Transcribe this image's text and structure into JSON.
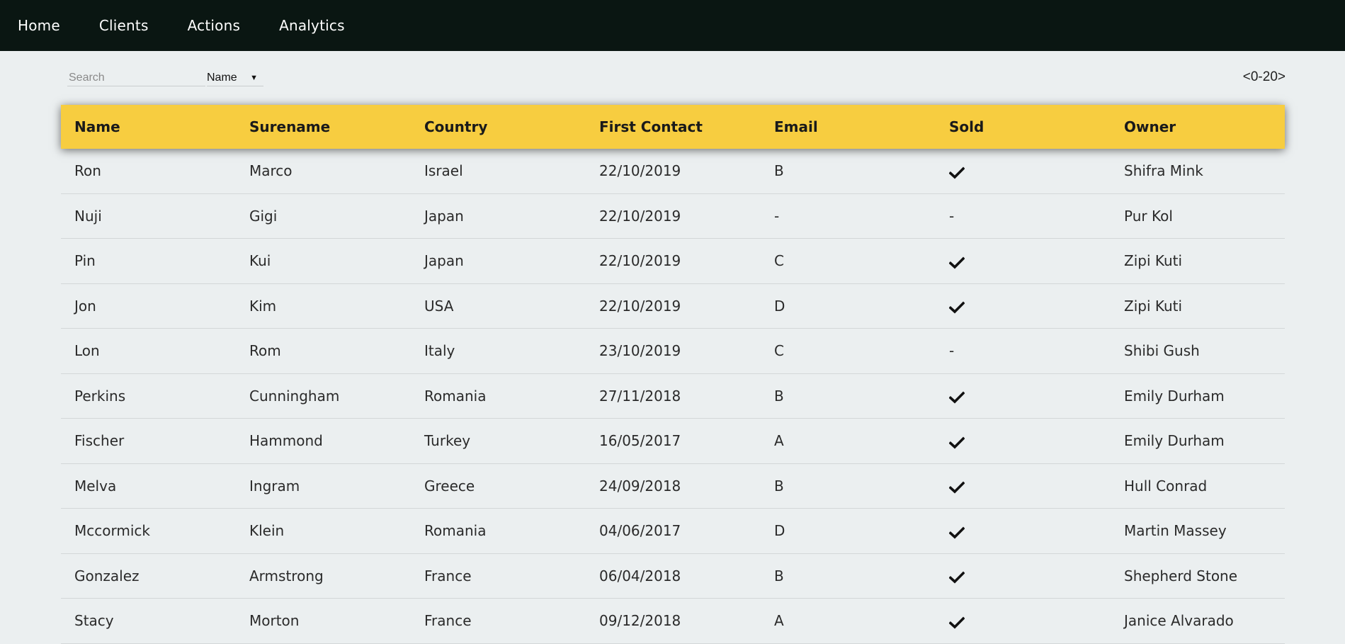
{
  "nav": {
    "items": [
      "Home",
      "Clients",
      "Actions",
      "Analytics"
    ]
  },
  "toolbar": {
    "search_placeholder": "Search",
    "select_value": "Name",
    "pagination": "<0-20>"
  },
  "table": {
    "headers": [
      "Name",
      "Surename",
      "Country",
      "First Contact",
      "Email",
      "Sold",
      "Owner"
    ],
    "rows": [
      [
        "Ron",
        "Marco",
        "Israel",
        "22/10/2019",
        "B",
        "check",
        "Shifra Mink"
      ],
      [
        "Nuji",
        "Gigi",
        "Japan",
        "22/10/2019",
        "-",
        "-",
        "Pur Kol"
      ],
      [
        "Pin",
        "Kui",
        "Japan",
        "22/10/2019",
        "C",
        "check",
        "Zipi Kuti"
      ],
      [
        "Jon",
        "Kim",
        "USA",
        "22/10/2019",
        "D",
        "check",
        "Zipi Kuti"
      ],
      [
        "Lon",
        "Rom",
        "Italy",
        "23/10/2019",
        "C",
        "-",
        "Shibi Gush"
      ],
      [
        "Perkins",
        "Cunningham",
        "Romania",
        "27/11/2018",
        "B",
        "check",
        "Emily Durham"
      ],
      [
        "Fischer",
        "Hammond",
        "Turkey",
        "16/05/2017",
        "A",
        "check",
        "Emily Durham"
      ],
      [
        "Melva",
        "Ingram",
        "Greece",
        "24/09/2018",
        "B",
        "check",
        "Hull Conrad"
      ],
      [
        "Mccormick",
        "Klein",
        "Romania",
        "04/06/2017",
        "D",
        "check",
        "Martin Massey"
      ],
      [
        "Gonzalez",
        "Armstrong",
        "France",
        "06/04/2018",
        "B",
        "check",
        "Shepherd Stone"
      ],
      [
        "Stacy",
        "Morton",
        "France",
        "09/12/2018",
        "A",
        "check",
        "Janice Alvarado"
      ]
    ]
  },
  "icons": {
    "sold_yes": "check-icon",
    "select_caret": "caret-down-icon"
  },
  "colors": {
    "navbar_bg": "#0a1612",
    "header_bg": "#f7cd40",
    "page_bg": "#ebeff0"
  }
}
